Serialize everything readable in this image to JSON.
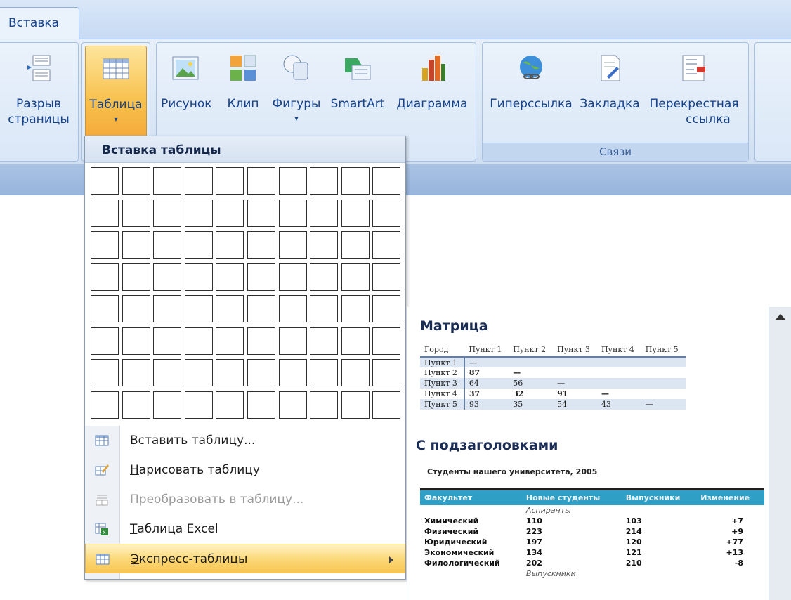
{
  "tab": {
    "label": "Вставка"
  },
  "ribbon": {
    "break_label_1": "Разрыв",
    "break_label_2": "страницы",
    "table": "Таблица",
    "picture": "Рисунок",
    "clip": "Клип",
    "shapes": "Фигуры",
    "smartart": "SmartArt",
    "chart": "Диаграмма",
    "hyperlink": "Гиперссылка",
    "bookmark": "Закладка",
    "crossref_1": "Перекрестная",
    "crossref_2": "ссылка",
    "links_group": "Связи"
  },
  "menu": {
    "header": "Вставка таблицы",
    "grid_cols": 10,
    "grid_rows": 8,
    "items": [
      {
        "label": "Вставить таблицу...",
        "key": "В",
        "rest": "ставить таблицу...",
        "icon": "insert-table-icon"
      },
      {
        "label": "Нарисовать таблицу",
        "key": "Н",
        "rest": "арисовать таблицу",
        "icon": "draw-table-icon"
      },
      {
        "label": "Преобразовать в таблицу...",
        "key": "П",
        "rest": "реобразовать в таблицу...",
        "icon": "convert-table-icon"
      },
      {
        "label": "Таблица Excel",
        "key": "Т",
        "rest": "аблица Excel",
        "icon": "excel-table-icon"
      },
      {
        "label": "Экспресс-таблицы",
        "key": "Э",
        "rest": "кспресс-таблицы",
        "icon": "quick-tables-icon"
      }
    ]
  },
  "gallery": {
    "matrix_title": "Матрица",
    "matrix_headers": [
      "Город",
      "Пункт 1",
      "Пункт 2",
      "Пункт 3",
      "Пункт 4",
      "Пункт 5"
    ],
    "matrix_rows": [
      [
        "Пункт 1",
        "—",
        "",
        "",
        "",
        ""
      ],
      [
        "Пункт 2",
        "87",
        "—",
        "",
        "",
        ""
      ],
      [
        "Пункт 3",
        "64",
        "56",
        "—",
        "",
        ""
      ],
      [
        "Пункт 4",
        "37",
        "32",
        "91",
        "—",
        ""
      ],
      [
        "Пункт 5",
        "93",
        "35",
        "54",
        "43",
        "—"
      ]
    ],
    "sub_title": "С подзаголовками",
    "sub_caption": "Студенты нашего университета, 2005",
    "sub_headers": [
      "Факультет",
      "Новые студенты",
      "Выпускники",
      "Изменение"
    ],
    "sub_section_1": "Аспиранты",
    "sub_rows": [
      [
        "Химический",
        "110",
        "103",
        "+7"
      ],
      [
        "Физический",
        "223",
        "214",
        "+9"
      ],
      [
        "Юридический",
        "197",
        "120",
        "+77"
      ],
      [
        "Экономический",
        "134",
        "121",
        "+13"
      ],
      [
        "Филологический",
        "202",
        "210",
        "-8"
      ]
    ],
    "sub_section_2": "Выпускники"
  }
}
